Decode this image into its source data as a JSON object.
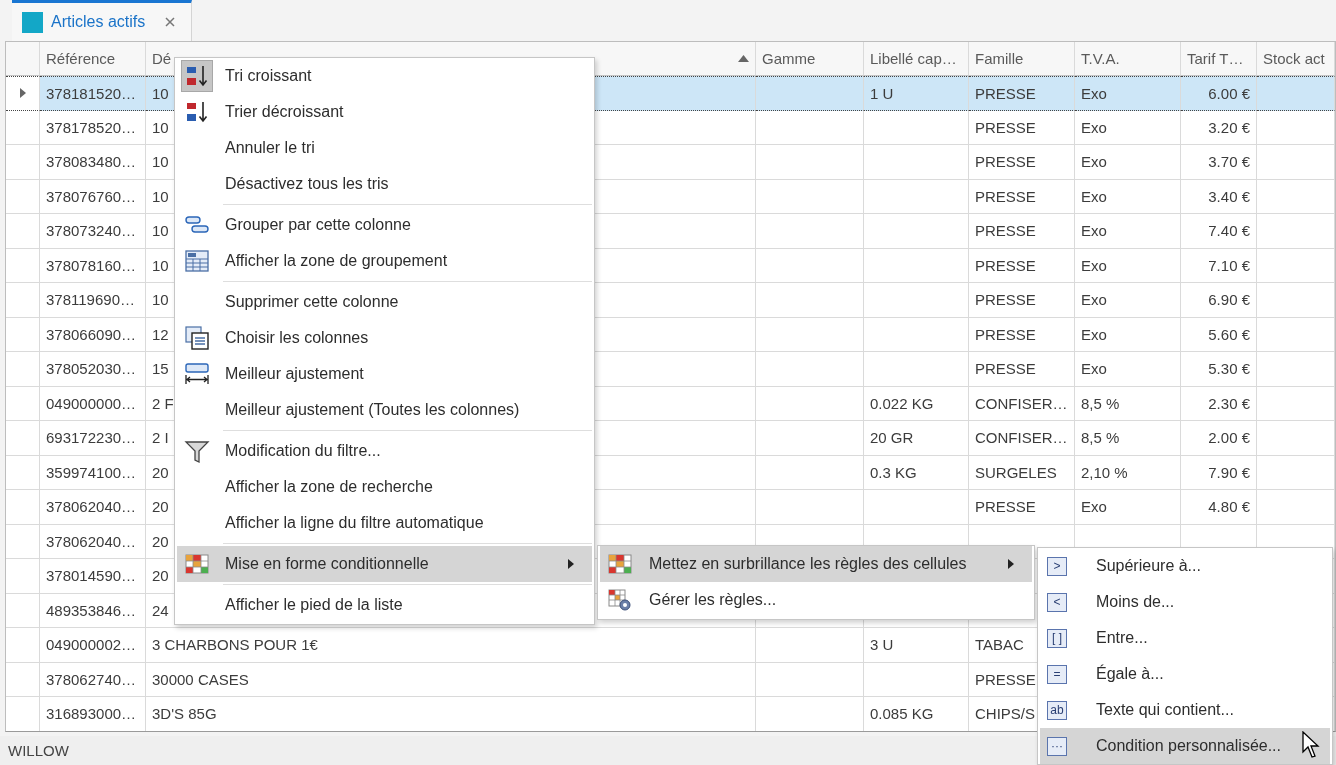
{
  "tab": {
    "label": "Articles actifs",
    "selected": true
  },
  "table": {
    "columns": [
      {
        "label": "Référence",
        "sorted": false
      },
      {
        "label": "Dé",
        "sorted": true
      },
      {
        "label": "Gamme",
        "sorted": false
      },
      {
        "label": "Libellé cap…",
        "sorted": false
      },
      {
        "label": "Famille",
        "sorted": false
      },
      {
        "label": "T.V.A.",
        "sorted": false
      },
      {
        "label": "Tarif T…",
        "sorted": false
      },
      {
        "label": "Stock act",
        "sorted": false
      }
    ],
    "rows": [
      {
        "selected": true,
        "cells": {
          "reference": "378181520…",
          "designation": "10",
          "libelle": "1 U",
          "famille": "PRESSE",
          "tva": "Exo",
          "tarif": "6.00 €"
        }
      },
      {
        "selected": false,
        "cells": {
          "reference": "378178520…",
          "designation": "10",
          "famille": "PRESSE",
          "tva": "Exo",
          "tarif": "3.20 €"
        }
      },
      {
        "selected": false,
        "cells": {
          "reference": "378083480…",
          "designation": "10",
          "famille": "PRESSE",
          "tva": "Exo",
          "tarif": "3.70 €"
        }
      },
      {
        "selected": false,
        "cells": {
          "reference": "378076760…",
          "designation": "10",
          "famille": "PRESSE",
          "tva": "Exo",
          "tarif": "3.40 €"
        }
      },
      {
        "selected": false,
        "cells": {
          "reference": "378073240…",
          "designation": "10",
          "famille": "PRESSE",
          "tva": "Exo",
          "tarif": "7.40 €"
        }
      },
      {
        "selected": false,
        "cells": {
          "reference": "378078160…",
          "designation": "10",
          "famille": "PRESSE",
          "tva": "Exo",
          "tarif": "7.10 €"
        }
      },
      {
        "selected": false,
        "cells": {
          "reference": "378119690…",
          "designation": "10",
          "famille": "PRESSE",
          "tva": "Exo",
          "tarif": "6.90 €"
        }
      },
      {
        "selected": false,
        "cells": {
          "reference": "378066090…",
          "designation": "12",
          "famille": "PRESSE",
          "tva": "Exo",
          "tarif": "5.60 €"
        }
      },
      {
        "selected": false,
        "cells": {
          "reference": "378052030…",
          "designation": "15",
          "famille": "PRESSE",
          "tva": "Exo",
          "tarif": "5.30 €"
        }
      },
      {
        "selected": false,
        "cells": {
          "reference": "049000000…",
          "designation": "2 F",
          "libelle": "0.022 KG",
          "famille": "CONFISER…",
          "tva": "8,5 %",
          "tarif": "2.30 €"
        }
      },
      {
        "selected": false,
        "cells": {
          "reference": "693172230…",
          "designation": "2 I",
          "libelle": "20 GR",
          "famille": "CONFISER…",
          "tva": "8,5 %",
          "tarif": "2.00 €"
        }
      },
      {
        "selected": false,
        "cells": {
          "reference": "359974100…",
          "designation": "20",
          "libelle": "0.3 KG",
          "famille": "SURGELES",
          "tva": "2,10 %",
          "tarif": "7.90 €"
        }
      },
      {
        "selected": false,
        "cells": {
          "reference": "378062040…",
          "designation": "20",
          "famille": "PRESSE",
          "tva": "Exo",
          "tarif": "4.80 €"
        }
      },
      {
        "selected": false,
        "cells": {
          "reference": "378062040…",
          "designation": "20"
        }
      },
      {
        "selected": false,
        "cells": {
          "reference": "378014590…",
          "designation": "20"
        }
      },
      {
        "selected": false,
        "cells": {
          "reference": "489353846…",
          "designation": "24"
        }
      },
      {
        "selected": false,
        "cells": {
          "reference": "049000002…",
          "designation": "3 CHARBONS POUR 1€",
          "libelle": "3 U",
          "famille": "TABAC"
        }
      },
      {
        "selected": false,
        "cells": {
          "reference": "378062740…",
          "designation": "30000 CASES",
          "famille": "PRESSE"
        }
      },
      {
        "selected": false,
        "cells": {
          "reference": "316893000…",
          "designation": "3D'S 85G",
          "libelle": "0.085 KG",
          "famille": "CHIPS/S"
        }
      }
    ]
  },
  "context_menu": {
    "items": [
      {
        "label": "Tri croissant",
        "checked": true,
        "highlighted": false,
        "separator_before": false,
        "has_submenu": false
      },
      {
        "label": "Trier décroissant",
        "checked": false,
        "highlighted": false,
        "separator_before": false,
        "has_submenu": false
      },
      {
        "label": "Annuler le tri",
        "checked": false,
        "highlighted": false,
        "separator_before": false,
        "has_submenu": false
      },
      {
        "label": "Désactivez tous les tris",
        "checked": false,
        "highlighted": false,
        "separator_before": false,
        "has_submenu": false
      },
      {
        "label": "Grouper par cette colonne",
        "checked": false,
        "highlighted": false,
        "separator_before": true,
        "has_submenu": false
      },
      {
        "label": "Afficher la zone de groupement",
        "checked": false,
        "highlighted": false,
        "separator_before": false,
        "has_submenu": false
      },
      {
        "label": "Supprimer cette colonne",
        "checked": false,
        "highlighted": false,
        "separator_before": true,
        "has_submenu": false
      },
      {
        "label": "Choisir les colonnes",
        "checked": false,
        "highlighted": false,
        "separator_before": false,
        "has_submenu": false
      },
      {
        "label": "Meilleur ajustement",
        "checked": false,
        "highlighted": false,
        "separator_before": false,
        "has_submenu": false
      },
      {
        "label": "Meilleur ajustement (Toutes les colonnes)",
        "checked": false,
        "highlighted": false,
        "separator_before": false,
        "has_submenu": false
      },
      {
        "label": "Modification du filtre...",
        "checked": false,
        "highlighted": false,
        "separator_before": true,
        "has_submenu": false
      },
      {
        "label": "Afficher la zone de recherche",
        "checked": false,
        "highlighted": false,
        "separator_before": false,
        "has_submenu": false
      },
      {
        "label": "Afficher la ligne du filtre automatique",
        "checked": false,
        "highlighted": false,
        "separator_before": false,
        "has_submenu": false
      },
      {
        "label": "Mise en forme conditionnelle",
        "checked": false,
        "highlighted": true,
        "separator_before": true,
        "has_submenu": true
      },
      {
        "label": "Afficher le pied de la liste",
        "checked": false,
        "highlighted": false,
        "separator_before": true,
        "has_submenu": false
      }
    ]
  },
  "submenu": {
    "items": [
      {
        "label": "Mettez en surbrillance les règles des cellules",
        "highlighted": true,
        "has_submenu": true
      },
      {
        "label": "Gérer les règles...",
        "highlighted": false,
        "has_submenu": false
      }
    ]
  },
  "rules_menu": {
    "items": [
      {
        "symbol": ">",
        "label": "Supérieure à...",
        "highlighted": false
      },
      {
        "symbol": "<",
        "label": "Moins de...",
        "highlighted": false
      },
      {
        "symbol": "[ ]",
        "label": "Entre...",
        "highlighted": false
      },
      {
        "symbol": "=",
        "label": "Égale à...",
        "highlighted": false
      },
      {
        "symbol": "ab",
        "label": "Texte qui contient...",
        "highlighted": false
      },
      {
        "symbol": "···",
        "label": "Condition personnalisée...",
        "highlighted": true
      }
    ]
  },
  "status_bar": {
    "text": "WILLOW"
  }
}
